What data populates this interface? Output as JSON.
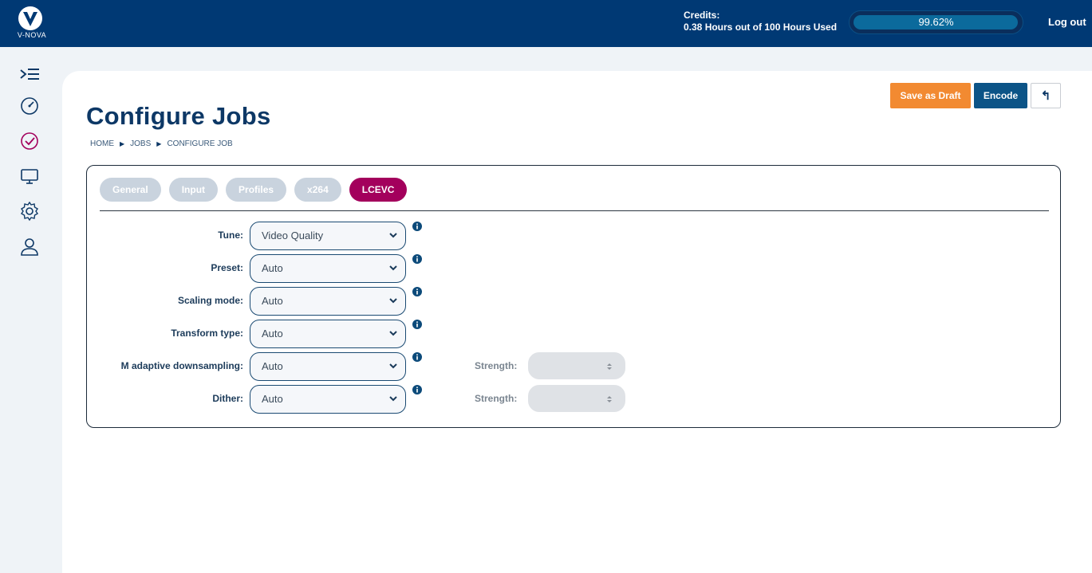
{
  "brand": {
    "logo_text": "V-NOVA"
  },
  "header": {
    "credits_label": "Credits:",
    "credits_detail": "0.38 Hours out of 100 Hours Used",
    "usage_percent": 99.62,
    "usage_text": "99.62%",
    "logout_label": "Log out"
  },
  "sidebar": {
    "items": [
      {
        "name": "menu-toggle-icon"
      },
      {
        "name": "dashboard-gauge-icon"
      },
      {
        "name": "jobs-check-icon"
      },
      {
        "name": "monitor-icon"
      },
      {
        "name": "settings-gear-icon"
      },
      {
        "name": "user-profile-icon"
      }
    ]
  },
  "page": {
    "title": "Configure Jobs",
    "breadcrumb": [
      "HOME",
      "JOBS",
      "CONFIGURE JOB"
    ]
  },
  "toolbar": {
    "save_draft_label": "Save as Draft",
    "encode_label": "Encode",
    "back_icon": "↰"
  },
  "tabs": [
    {
      "label": "General",
      "active": false
    },
    {
      "label": "Input",
      "active": false
    },
    {
      "label": "Profiles",
      "active": false
    },
    {
      "label": "x264",
      "active": false
    },
    {
      "label": "LCEVC",
      "active": true
    }
  ],
  "form": {
    "fields": [
      {
        "label": "Tune:",
        "value": "Video Quality"
      },
      {
        "label": "Preset:",
        "value": "Auto"
      },
      {
        "label": "Scaling mode:",
        "value": "Auto"
      },
      {
        "label": "Transform type:",
        "value": "Auto"
      },
      {
        "label": "M adaptive downsampling:",
        "value": "Auto",
        "strength_label": "Strength:",
        "strength_value": ""
      },
      {
        "label": "Dither:",
        "value": "Auto",
        "strength_label": "Strength:",
        "strength_value": ""
      }
    ]
  },
  "colors": {
    "header_bg": "#003974",
    "accent_active_tab": "#a3005c",
    "draft_button": "#f28a31",
    "encode_button": "#0c5487"
  }
}
